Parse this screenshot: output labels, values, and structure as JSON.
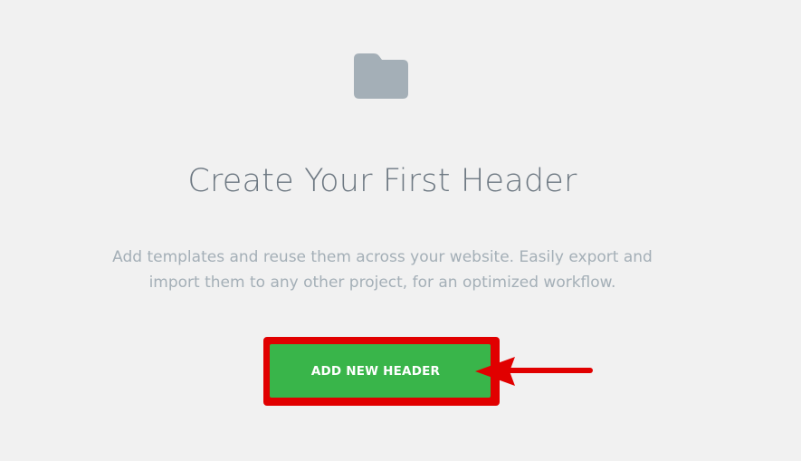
{
  "empty_state": {
    "icon": "folder-icon",
    "title": "Create Your First Header",
    "description": "Add templates and reuse them across your website. Easily export and import them to any other project, for an optimized workflow.",
    "add_button_label": "ADD NEW HEADER"
  },
  "annotation": {
    "highlight_color": "#e10000",
    "arrow_icon": "arrow-left-icon"
  },
  "colors": {
    "background": "#f1f1f1",
    "folder_icon": "#a4afb7",
    "title_text": "#6d7882",
    "description_text": "#a4afb7",
    "button": "#39b54a",
    "button_text": "#ffffff"
  }
}
